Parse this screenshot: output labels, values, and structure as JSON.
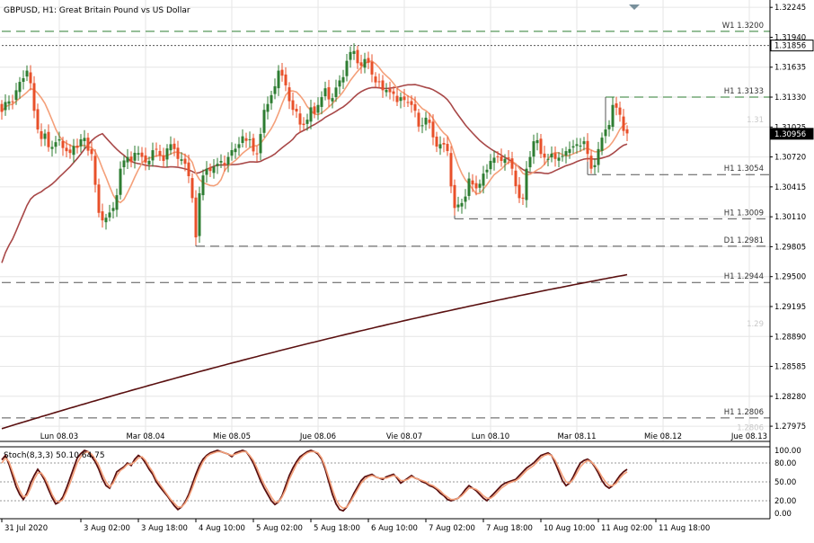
{
  "chart_data": {
    "type": "candlestick",
    "title": "GBPUSD, H1:  Great Britain Pound vs US Dollar",
    "price_axis": {
      "ylim": [
        1.2782,
        1.3232
      ],
      "ticks": [
        "1.32245",
        "1.31940",
        "1.31635",
        "1.31330",
        "1.31025",
        "1.30720",
        "1.30415",
        "1.30110",
        "1.29805",
        "1.29500",
        "1.29195",
        "1.28890",
        "1.28585",
        "1.28280",
        "1.27975"
      ]
    },
    "candle_count": 175,
    "date_axis": [
      {
        "label": "Lun 08.03",
        "bar": 16
      },
      {
        "label": "Mar 08.04",
        "bar": 40
      },
      {
        "label": "Mie 08.05",
        "bar": 64
      },
      {
        "label": "Jue 08.06",
        "bar": 88
      },
      {
        "label": "Vie 08.07",
        "bar": 112
      },
      {
        "label": "Lun 08.10",
        "bar": 136
      },
      {
        "label": "Mar 08.11",
        "bar": 160
      },
      {
        "label": "Mie 08.12",
        "bar": 184
      },
      {
        "label": "Jue 08.13",
        "bar": 208
      }
    ],
    "time_axis": [
      {
        "label": "31 Jul 2020",
        "bar": 0
      },
      {
        "label": "3 Aug 02:00",
        "bar": 22
      },
      {
        "label": "3 Aug 18:00",
        "bar": 38
      },
      {
        "label": "4 Aug 10:00",
        "bar": 54
      },
      {
        "label": "5 Aug 02:00",
        "bar": 70
      },
      {
        "label": "5 Aug 18:00",
        "bar": 86
      },
      {
        "label": "6 Aug 10:00",
        "bar": 102
      },
      {
        "label": "7 Aug 02:00",
        "bar": 118
      },
      {
        "label": "7 Aug 18:00",
        "bar": 134
      },
      {
        "label": "10 Aug 10:00",
        "bar": 150
      },
      {
        "label": "11 Aug 02:00",
        "bar": 166
      },
      {
        "label": "11 Aug 18:00",
        "bar": 182
      }
    ],
    "anchors": [
      [
        0,
        1.3118
      ],
      [
        4,
        1.314
      ],
      [
        7,
        1.316
      ],
      [
        10,
        1.31
      ],
      [
        13,
        1.3082
      ],
      [
        16,
        1.309
      ],
      [
        19,
        1.3076
      ],
      [
        22,
        1.309
      ],
      [
        25,
        1.3075
      ],
      [
        27,
        1.3015
      ],
      [
        29,
        1.301
      ],
      [
        31,
        1.302
      ],
      [
        33,
        1.306
      ],
      [
        35,
        1.3072
      ],
      [
        38,
        1.3076
      ],
      [
        41,
        1.3068
      ],
      [
        43,
        1.308
      ],
      [
        45,
        1.3068
      ],
      [
        47,
        1.3085
      ],
      [
        49,
        1.307
      ],
      [
        51,
        1.3065
      ],
      [
        53,
        1.303
      ],
      [
        54,
        1.299
      ],
      [
        55,
        1.3035
      ],
      [
        57,
        1.306
      ],
      [
        60,
        1.3065
      ],
      [
        63,
        1.3072
      ],
      [
        66,
        1.3085
      ],
      [
        69,
        1.309
      ],
      [
        71,
        1.3075
      ],
      [
        73,
        1.312
      ],
      [
        75,
        1.3135
      ],
      [
        77,
        1.316
      ],
      [
        79,
        1.3145
      ],
      [
        81,
        1.312
      ],
      [
        83,
        1.3105
      ],
      [
        85,
        1.311
      ],
      [
        88,
        1.3125
      ],
      [
        90,
        1.3142
      ],
      [
        92,
        1.3132
      ],
      [
        94,
        1.315
      ],
      [
        96,
        1.317
      ],
      [
        98,
        1.318
      ],
      [
        100,
        1.3165
      ],
      [
        102,
        1.3168
      ],
      [
        104,
        1.3148
      ],
      [
        106,
        1.314
      ],
      [
        108,
        1.3138
      ],
      [
        110,
        1.3128
      ],
      [
        112,
        1.313
      ],
      [
        114,
        1.3125
      ],
      [
        116,
        1.3103
      ],
      [
        118,
        1.3112
      ],
      [
        120,
        1.3092
      ],
      [
        122,
        1.3085
      ],
      [
        124,
        1.3078
      ],
      [
        126,
        1.302
      ],
      [
        128,
        1.3025
      ],
      [
        130,
        1.305
      ],
      [
        132,
        1.304
      ],
      [
        134,
        1.3055
      ],
      [
        136,
        1.3068
      ],
      [
        138,
        1.3072
      ],
      [
        140,
        1.307
      ],
      [
        142,
        1.306
      ],
      [
        144,
        1.303
      ],
      [
        145,
        1.303
      ],
      [
        146,
        1.306
      ],
      [
        148,
        1.3088
      ],
      [
        150,
        1.3075
      ],
      [
        152,
        1.307
      ],
      [
        154,
        1.307
      ],
      [
        156,
        1.3073
      ],
      [
        158,
        1.308
      ],
      [
        160,
        1.3085
      ],
      [
        162,
        1.3088
      ],
      [
        164,
        1.306
      ],
      [
        166,
        1.308
      ],
      [
        168,
        1.31
      ],
      [
        170,
        1.3125
      ],
      [
        172,
        1.3115
      ],
      [
        174,
        1.3096
      ]
    ],
    "series": [
      {
        "name": "Stoch(8,3,3) main",
        "color": "#5a1010",
        "values": [
          85,
          92,
          78,
          60,
          42,
          30,
          22,
          32,
          48,
          60,
          70,
          62,
          52,
          38,
          25,
          15,
          18,
          26,
          40,
          56,
          72,
          88,
          95,
          100,
          98,
          90,
          82,
          70,
          55,
          44,
          40,
          52,
          66,
          70,
          74,
          80,
          76,
          86,
          92,
          88,
          80,
          70,
          62,
          50,
          42,
          35,
          28,
          20,
          12,
          6,
          10,
          18,
          30,
          46,
          62,
          76,
          86,
          92,
          96,
          98,
          100,
          98,
          96,
          94,
          90,
          96,
          98,
          100,
          98,
          90,
          80,
          66,
          52,
          40,
          30,
          20,
          14,
          18,
          28,
          44,
          60,
          72,
          82,
          90,
          94,
          98,
          100,
          98,
          94,
          86,
          70,
          50,
          30,
          15,
          6,
          4,
          10,
          20,
          32,
          42,
          52,
          58,
          60,
          62,
          58,
          56,
          54,
          58,
          60,
          62,
          56,
          48,
          52,
          56,
          60,
          56,
          54,
          50,
          48,
          44,
          42,
          38,
          32,
          28,
          22,
          20,
          22,
          24,
          30,
          38,
          44,
          40,
          36,
          30,
          24,
          20,
          26,
          32,
          38,
          44,
          48,
          50,
          52,
          54,
          60,
          66,
          72,
          76,
          80,
          86,
          92,
          94,
          96,
          92,
          80,
          66,
          52,
          44,
          48,
          58,
          70,
          80,
          84,
          86,
          82,
          74,
          64,
          52,
          44,
          40,
          44,
          52,
          60,
          66,
          70
        ]
      },
      {
        "name": "Stoch(8,3,3) signal",
        "color": "#f4a07a",
        "values": [
          80,
          88,
          82,
          66,
          50,
          36,
          26,
          28,
          40,
          54,
          64,
          64,
          56,
          44,
          30,
          20,
          18,
          22,
          34,
          48,
          64,
          80,
          90,
          96,
          98,
          94,
          86,
          76,
          62,
          50,
          42,
          48,
          60,
          68,
          72,
          78,
          78,
          82,
          88,
          90,
          84,
          74,
          66,
          54,
          46,
          38,
          30,
          22,
          16,
          10,
          10,
          16,
          26,
          40,
          56,
          70,
          82,
          90,
          94,
          96,
          98,
          98,
          96,
          94,
          92,
          94,
          96,
          98,
          98,
          92,
          84,
          72,
          58,
          46,
          36,
          26,
          18,
          18,
          26,
          38,
          54,
          66,
          78,
          86,
          92,
          96,
          98,
          98,
          96,
          88,
          74,
          56,
          38,
          22,
          12,
          8,
          10,
          18,
          28,
          38,
          48,
          54,
          58,
          60,
          58,
          56,
          56,
          56,
          58,
          60,
          58,
          52,
          52,
          54,
          58,
          56,
          54,
          52,
          50,
          46,
          44,
          40,
          36,
          30,
          26,
          22,
          22,
          24,
          28,
          34,
          40,
          40,
          38,
          34,
          28,
          24,
          24,
          28,
          34,
          40,
          44,
          48,
          50,
          52,
          56,
          62,
          68,
          72,
          76,
          82,
          88,
          92,
          94,
          92,
          84,
          72,
          60,
          50,
          48,
          54,
          64,
          74,
          80,
          84,
          82,
          76,
          68,
          58,
          50,
          44,
          44,
          48,
          56,
          62,
          66
        ]
      }
    ],
    "levels": [
      {
        "label": "W1 1.3200",
        "value": 1.32,
        "x1_bar": 0,
        "color": "#2e7d32",
        "dash": "10,6",
        "label_color": "#2e7d32"
      },
      {
        "label": "",
        "value": 1.31856,
        "x1_bar": 0,
        "color": "#555555",
        "dash": "2,2"
      },
      {
        "label": "H1 1.3133",
        "value": 1.3133,
        "x1_bar": 168,
        "color": "#2e7d32",
        "dash": "10,6",
        "label_color": "#2e7d32"
      },
      {
        "label": "H1 1.3054",
        "value": 1.3054,
        "x1_bar": 163,
        "color": "#555555",
        "dash": "10,6",
        "label_color": "#333333"
      },
      {
        "label": "H1 1.3009",
        "value": 1.3009,
        "x1_bar": 126,
        "color": "#555555",
        "dash": "10,6",
        "label_color": "#333333"
      },
      {
        "label": "D1 1.2981",
        "value": 1.2981,
        "x1_bar": 54,
        "color": "#555555",
        "dash": "10,6",
        "label_color": "#333333"
      },
      {
        "label": "H1 1.2944",
        "value": 1.2944,
        "x1_bar": 0,
        "color": "#555555",
        "dash": "10,6",
        "label_color": "#333333"
      },
      {
        "label": "H1 1.2806",
        "value": 1.2806,
        "x1_bar": 0,
        "color": "#555555",
        "dash": "10,6",
        "label_color": "#333333"
      }
    ],
    "faint_labels": [
      {
        "text": "1.31",
        "value": 1.311
      },
      {
        "text": "1.29",
        "value": 1.2902
      },
      {
        "text": "1.2806",
        "value": 1.2796
      }
    ],
    "price_boxes": [
      {
        "text": "1.31856",
        "value": 1.31856,
        "bg": "#ffffff",
        "fg": "#000000"
      },
      {
        "text": "1.30956",
        "value": 1.30956,
        "bg": "#000000",
        "fg": "#ffffff"
      }
    ],
    "ma200": {
      "start": 1.2795,
      "end": 1.2952
    },
    "stoch": {
      "label": "Stoch(8,3,3) 50.10 64.75",
      "ticks": [
        "100.00",
        "80.00",
        "50.00",
        "20.00",
        "0.00"
      ],
      "levels": [
        80,
        50,
        20
      ]
    },
    "colors": {
      "bull": "#2e7d32",
      "bear": "#e8502a",
      "ma_fast": "#f4a07a",
      "ma_slow": "#a84848",
      "ma_200": "#5a1010",
      "grid": "#e6e6e6"
    }
  }
}
